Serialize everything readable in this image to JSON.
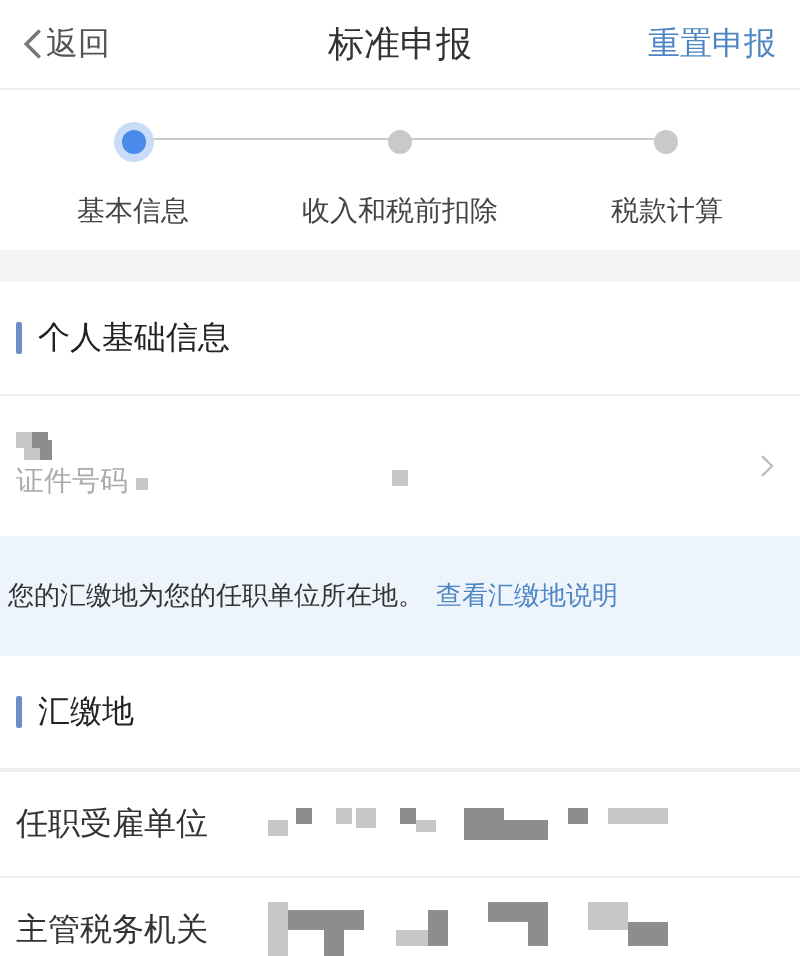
{
  "nav": {
    "back": "返回",
    "title": "标准申报",
    "action": "重置申报"
  },
  "steps": [
    {
      "label": "基本信息",
      "selected": true
    },
    {
      "label": "收入和税前扣除",
      "selected": false
    },
    {
      "label": "税款计算",
      "selected": false
    }
  ],
  "personal_section": {
    "title": "个人基础信息",
    "id_label": "证件号码"
  },
  "notice": {
    "text": "您的汇缴地为您的任职单位所在地。",
    "link": "查看汇缴地说明"
  },
  "filing_section": {
    "title": "汇缴地",
    "rows": [
      {
        "label": "任职受雇单位"
      },
      {
        "label": "主管税务机关"
      }
    ]
  }
}
